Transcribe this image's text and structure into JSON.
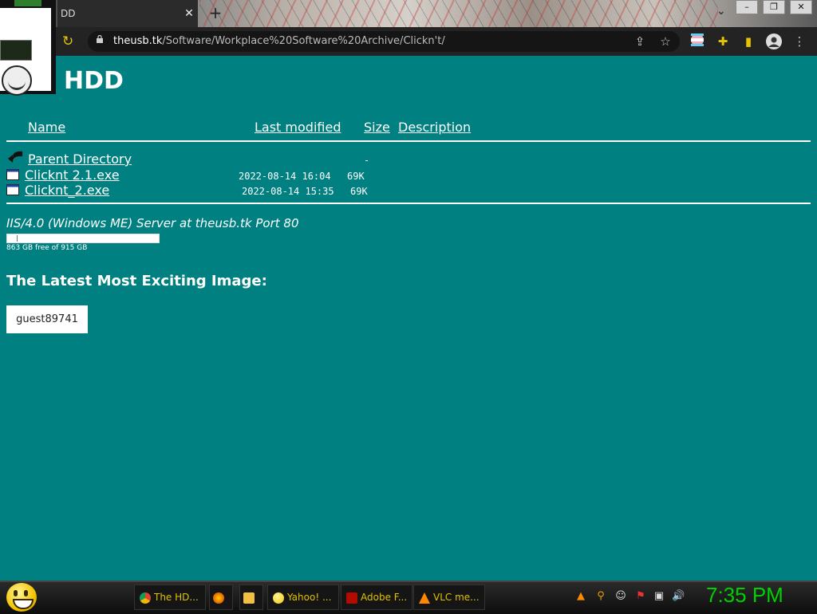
{
  "browser": {
    "tab_title": "DD",
    "tab_close": "✕",
    "new_tab": "+",
    "url_host": "theusb.tk",
    "url_path": "/Software/Workplace%20Software%20Archive/Clickn't/"
  },
  "page": {
    "title": "HDD",
    "columns": {
      "name": "Name",
      "last_modified": "Last modified",
      "size": "Size",
      "description": "Description"
    },
    "parent": {
      "label": "Parent Directory",
      "size": "-"
    },
    "files": [
      {
        "name": "Clicknt 2.1.exe",
        "modified": "2022-08-14 16:04",
        "size": "69K"
      },
      {
        "name": "Clicknt_2.exe",
        "modified": "2022-08-14 15:35",
        "size": "69K"
      }
    ],
    "server": "IIS/4.0 (Windows ME) Server at theusb.tk Port 80",
    "disk": {
      "text": "863 GB free of 915 GB",
      "used_fraction": 0.057
    },
    "latest_heading": "The Latest Most Exciting Image:",
    "user_button": "guest89741"
  },
  "taskbar": {
    "items": [
      {
        "label": "The HD..."
      },
      {
        "label": "Yahoo! ..."
      },
      {
        "label": "Adobe F..."
      },
      {
        "label": "VLC me..."
      }
    ],
    "clock": "7:35 PM"
  },
  "colors": {
    "page_bg": "#008080",
    "clock": "#00d000",
    "taskbar_text": "#e0c000"
  }
}
